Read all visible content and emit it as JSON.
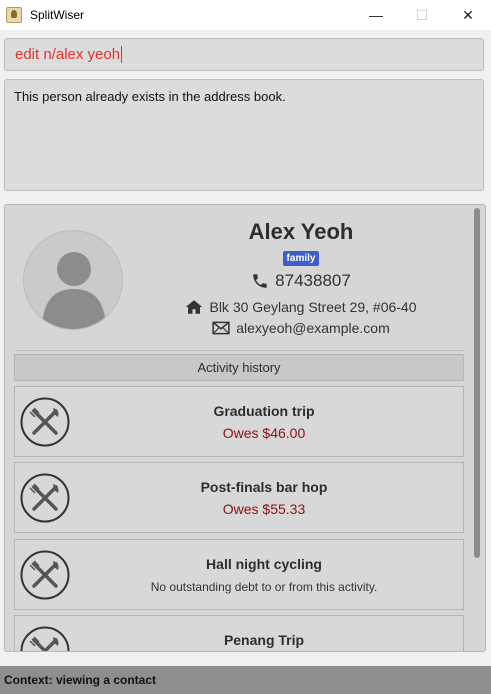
{
  "window": {
    "title": "SplitWiser",
    "minimize": "—",
    "maximize": "☐",
    "close": "✕"
  },
  "command": {
    "value": "edit n/alex yeoh"
  },
  "result": {
    "message": "This person already exists in the address book."
  },
  "contact": {
    "name": "Alex Yeoh",
    "tag": "family",
    "phone": "87438807",
    "address": "Blk 30 Geylang Street 29, #06-40",
    "email": "alexyeoh@example.com"
  },
  "activity_history": {
    "header": "Activity history",
    "items": [
      {
        "title": "Graduation trip",
        "status": "Owes $46.00",
        "kind": "owes"
      },
      {
        "title": "Post-finals bar hop",
        "status": "Owes $55.33",
        "kind": "owes"
      },
      {
        "title": "Hall night cycling",
        "status": "No outstanding debt to or from this activity.",
        "kind": "neutral"
      },
      {
        "title": "Penang Trip",
        "status": "",
        "kind": "owes"
      }
    ]
  },
  "status_bar": {
    "text": "Context: viewing a contact"
  },
  "colors": {
    "command_text": "#e2322a",
    "tag_bg": "#3d5ec9",
    "owes_text": "#8b1111"
  },
  "icons": [
    "app-icon",
    "phone-icon",
    "home-icon",
    "mail-icon",
    "utensils-icon",
    "avatar-placeholder-icon"
  ]
}
